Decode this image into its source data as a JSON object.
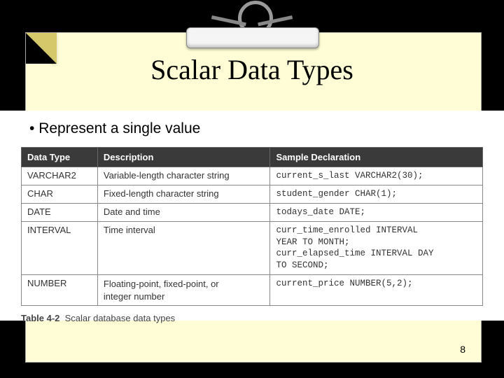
{
  "title": "Scalar Data Types",
  "bullet": "Represent a single value",
  "columns": [
    "Data Type",
    "Description",
    "Sample Declaration"
  ],
  "rows": [
    {
      "type": "VARCHAR2",
      "desc": "Variable-length character string",
      "sample": "current_s_last VARCHAR2(30);"
    },
    {
      "type": "CHAR",
      "desc": "Fixed-length character string",
      "sample": "student_gender CHAR(1);"
    },
    {
      "type": "DATE",
      "desc": "Date and time",
      "sample": "todays_date DATE;"
    },
    {
      "type": "INTERVAL",
      "desc": "Time interval",
      "sample": "curr_time_enrolled INTERVAL\nYEAR TO MONTH;\ncurr_elapsed_time INTERVAL DAY\nTO SECOND;"
    },
    {
      "type": "NUMBER",
      "desc": "Floating-point, fixed-point, or\ninteger number",
      "sample": "current_price NUMBER(5,2);"
    }
  ],
  "caption_label": "Table 4-2",
  "caption_text": "Scalar database data types",
  "page_number": "8"
}
